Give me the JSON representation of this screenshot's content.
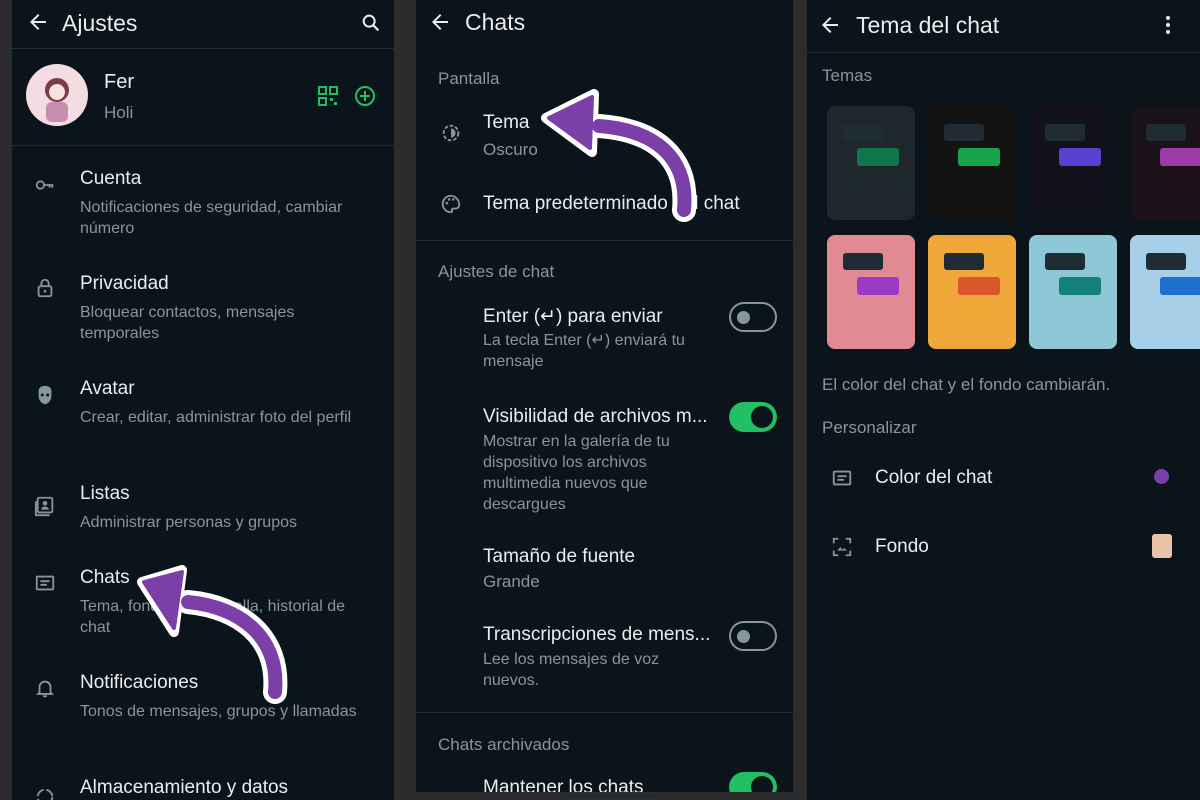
{
  "settings": {
    "title": "Ajustes",
    "profile": {
      "name": "Fer",
      "status": "Holi"
    },
    "items": [
      {
        "title": "Cuenta",
        "sub": "Notificaciones de seguridad, cambiar número"
      },
      {
        "title": "Privacidad",
        "sub": "Bloquear contactos, mensajes temporales"
      },
      {
        "title": "Avatar",
        "sub": "Crear, editar, administrar foto del perfil"
      },
      {
        "title": "Listas",
        "sub": "Administrar personas y grupos"
      },
      {
        "title": "Chats",
        "sub": "Tema, fondos de pantalla, historial de chat"
      },
      {
        "title": "Notificaciones",
        "sub": "Tonos de mensajes, grupos y llamadas"
      },
      {
        "title": "Almacenamiento y datos",
        "sub": ""
      }
    ]
  },
  "chats": {
    "title": "Chats",
    "section_display": "Pantalla",
    "theme": {
      "title": "Tema",
      "value": "Oscuro"
    },
    "default_theme": "Tema predeterminado del chat",
    "section_chat_settings": "Ajustes de chat",
    "enter_send": {
      "title": "Enter (↵) para enviar",
      "sub": "La tecla Enter (↵) enviará tu mensaje",
      "on": false
    },
    "media_visibility": {
      "title": "Visibilidad de archivos m...",
      "sub": "Mostrar en la galería de tu dispositivo los archivos multimedia nuevos que descargues",
      "on": true
    },
    "font_size": {
      "title": "Tamaño de fuente",
      "value": "Grande"
    },
    "transcriptions": {
      "title": "Transcripciones de mens...",
      "sub": "Lee los mensajes de voz nuevos.",
      "on": false
    },
    "section_archived": "Chats archivados",
    "keep_archived": {
      "title": "Mantener los chats",
      "on": true
    }
  },
  "chat_theme": {
    "title": "Tema del chat",
    "section_themes": "Temas",
    "themes": [
      {
        "bg": "#1e272c",
        "accent": "#11754a"
      },
      {
        "bg": "#131313",
        "accent": "#16a34a"
      },
      {
        "bg": "#12121a",
        "accent": "#5b3fd0"
      },
      {
        "bg": "#1a1218",
        "accent": "#9c3aa8"
      },
      {
        "bg": "#e28a94",
        "accent": "#9b3ac7"
      },
      {
        "bg": "#f0a73a",
        "accent": "#d9562b"
      },
      {
        "bg": "#8ec7d8",
        "accent": "#13807a"
      },
      {
        "bg": "#a7d0e8",
        "accent": "#1e6fd0"
      }
    ],
    "note": "El color del chat y el fondo cambiarán.",
    "section_custom": "Personalizar",
    "chat_color": {
      "label": "Color del chat",
      "swatch": "#7b3fa7"
    },
    "wallpaper": {
      "label": "Fondo",
      "swatch": "#e9c4a8"
    }
  },
  "colors": {
    "accent_green": "#21c063",
    "annotation_purple": "#7b3fa7",
    "background": "#0b141a"
  }
}
